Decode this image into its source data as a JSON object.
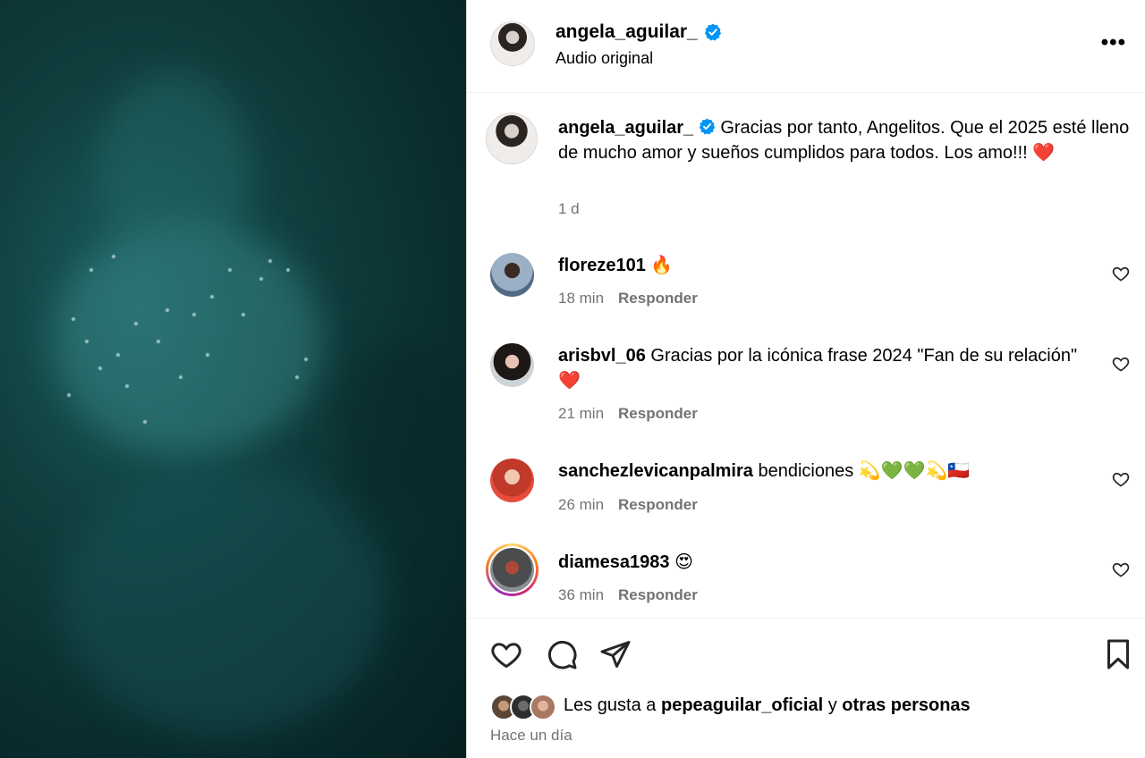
{
  "post": {
    "author": "angela_aguilar_",
    "audio": "Audio original",
    "more_icon": "more-options-icon",
    "verified_color": "#0095f6"
  },
  "caption": {
    "author": "angela_aguilar_",
    "text": "Gracias por tanto, Angelitos. Que el 2025 esté lleno de mucho amor y sueños cumplidos para todos. Los amo!!! ❤️",
    "time": "1 d"
  },
  "comments": [
    {
      "user": "floreze101",
      "text": "🔥",
      "time": "18 min",
      "reply": "Responder"
    },
    {
      "user": "arisbvl_06",
      "text": "Gracias por la icónica frase 2024 \"Fan de su relación\" ❤️",
      "time": "21 min",
      "reply": "Responder"
    },
    {
      "user": "sanchezlevicanpalmira",
      "text": "bendiciones 💫💚💚💫🇨🇱",
      "time": "26 min",
      "reply": "Responder"
    },
    {
      "user": "diamesa1983",
      "text": "😍",
      "time": "36 min",
      "reply": "Responder"
    }
  ],
  "actions": {
    "likes_prefix": "Les gusta a",
    "likes_user": "pepeaguilar_oficial",
    "likes_and": "y",
    "likes_others": "otras personas",
    "timestamp": "Hace un día"
  }
}
